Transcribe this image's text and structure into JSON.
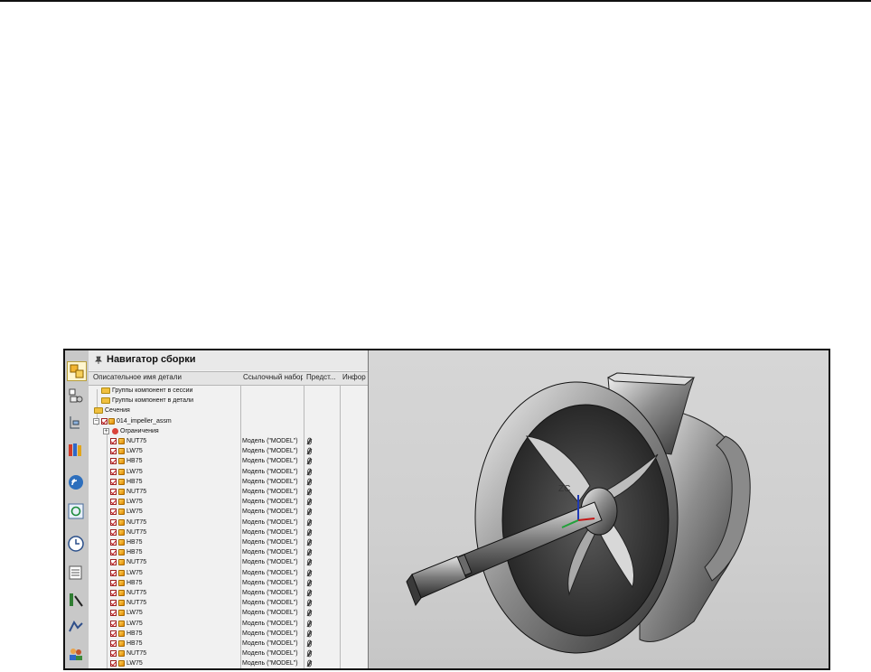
{
  "panel": {
    "title": "Навигатор сборки"
  },
  "columns": [
    "Описательное имя детали",
    "Ссылочный набор",
    "Предст...",
    "Инфор"
  ],
  "tree": [
    {
      "label": "Группы компонент в сессии",
      "kind": "folder",
      "level": 1
    },
    {
      "label": "Группы компонент в детали",
      "kind": "folder",
      "level": 1
    },
    {
      "label": "Сечения",
      "kind": "folder",
      "level": 0
    },
    {
      "label": "014_impeller_assm",
      "kind": "assembly",
      "level": 0
    },
    {
      "label": "Ограничения",
      "kind": "constraints",
      "level": 1
    },
    {
      "label": "NUT75",
      "ref": "Модель (\"MODEL\")"
    },
    {
      "label": "LW75",
      "ref": "Модель (\"MODEL\")"
    },
    {
      "label": "HB75",
      "ref": "Модель (\"MODEL\")"
    },
    {
      "label": "LW75",
      "ref": "Модель (\"MODEL\")"
    },
    {
      "label": "HB75",
      "ref": "Модель (\"MODEL\")"
    },
    {
      "label": "NUT75",
      "ref": "Модель (\"MODEL\")"
    },
    {
      "label": "LW75",
      "ref": "Модель (\"MODEL\")"
    },
    {
      "label": "LW75",
      "ref": "Модель (\"MODEL\")"
    },
    {
      "label": "NUT75",
      "ref": "Модель (\"MODEL\")"
    },
    {
      "label": "NUT75",
      "ref": "Модель (\"MODEL\")"
    },
    {
      "label": "HB75",
      "ref": "Модель (\"MODEL\")"
    },
    {
      "label": "HB75",
      "ref": "Модель (\"MODEL\")"
    },
    {
      "label": "NUT75",
      "ref": "Модель (\"MODEL\")"
    },
    {
      "label": "LW75",
      "ref": "Модель (\"MODEL\")"
    },
    {
      "label": "HB75",
      "ref": "Модель (\"MODEL\")"
    },
    {
      "label": "NUT75",
      "ref": "Модель (\"MODEL\")"
    },
    {
      "label": "NUT75",
      "ref": "Модель (\"MODEL\")"
    },
    {
      "label": "LW75",
      "ref": "Модель (\"MODEL\")"
    },
    {
      "label": "LW75",
      "ref": "Модель (\"MODEL\")"
    },
    {
      "label": "HB75",
      "ref": "Модель (\"MODEL\")"
    },
    {
      "label": "HB75",
      "ref": "Модель (\"MODEL\")"
    },
    {
      "label": "NUT75",
      "ref": "Модель (\"MODEL\")"
    },
    {
      "label": "LW75",
      "ref": "Модель (\"MODEL\")"
    }
  ],
  "viewport": {
    "axis_label": "ZC"
  },
  "colors": {
    "highlight": "#fff6cf",
    "check": "#c0191d"
  }
}
